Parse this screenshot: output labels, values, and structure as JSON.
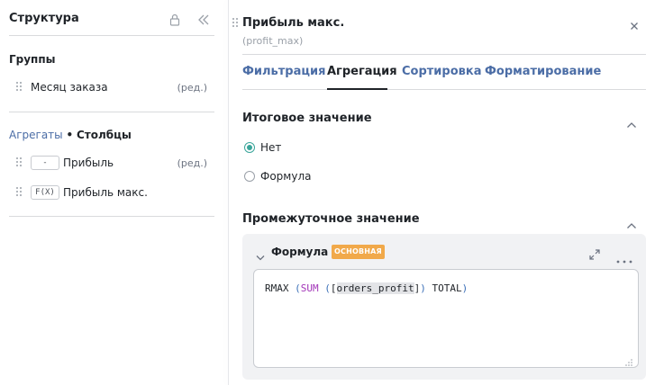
{
  "left": {
    "title": "Структура",
    "groups_title": "Группы",
    "groups": [
      {
        "label": "Месяц заказа",
        "edit": "(ред.)"
      }
    ],
    "aggregates_prefix": "Агрегаты",
    "aggregates_dot": "•",
    "aggregates_columns": "Столбцы",
    "aggregates": [
      {
        "chip": "-",
        "label": "Прибыль",
        "edit": "(ред.)"
      },
      {
        "chip": "F(X)",
        "label": "Прибыль макс."
      }
    ]
  },
  "right": {
    "title": "Прибыль макс.",
    "subtitle": "(profit_max)",
    "tabs": [
      "Фильтрация",
      "Агрегация",
      "Сортировка",
      "Форматирование"
    ],
    "active_tab": "Агрегация",
    "total_section": {
      "title": "Итоговое значение",
      "options": [
        "Нет",
        "Формула"
      ],
      "selected": "Нет"
    },
    "intermediate_section": {
      "title": "Промежуточное значение",
      "formula_title": "Формула",
      "badge": "ОСНОВНАЯ",
      "code": {
        "fn": "RMAX",
        "open1": "(",
        "kw": "SUM",
        "open2": "(",
        "field_open": "[",
        "field": "orders_profit",
        "field_close": "]",
        "close2": ")",
        "total": "TOTAL",
        "close1": ")"
      }
    }
  },
  "colors": {
    "accent_blue": "#4b6da6",
    "radio_green": "#3aa59a",
    "badge_orange": "#f1a94a",
    "keyword_purple": "#a235b8"
  }
}
